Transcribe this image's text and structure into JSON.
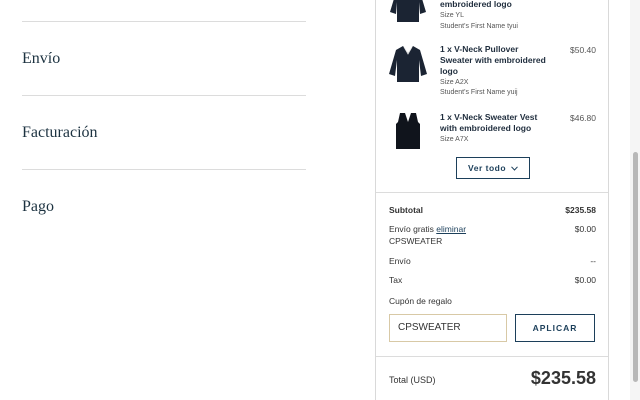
{
  "steps": [
    {
      "label": "Envío"
    },
    {
      "label": "Facturación"
    },
    {
      "label": "Pago"
    }
  ],
  "cart": {
    "items": [
      {
        "name": "embroidered logo",
        "size": "Size YL",
        "student": "Student's First Name tyui",
        "price": ""
      },
      {
        "name": "1 x V-Neck Pullover Sweater with embroidered logo",
        "size": "Size A2X",
        "student": "Student's First Name yuij",
        "price": "$50.40"
      },
      {
        "name": "1 x V-Neck Sweater Vest with embroidered logo",
        "size": "Size A7X",
        "student": "",
        "price": "$46.80"
      }
    ],
    "view_all_label": "Ver todo"
  },
  "summary": {
    "subtotal_label": "Subtotal",
    "subtotal_value": "$235.58",
    "free_shipping_label": "Envío gratis",
    "remove_label": "eliminar",
    "free_shipping_code": "CPSWEATER",
    "free_shipping_value": "$0.00",
    "shipping_label": "Envío",
    "shipping_value": "--",
    "tax_label": "Tax",
    "tax_value": "$0.00",
    "gift_coupon_label": "Cupón de regalo",
    "coupon_value": "CPSWEATER",
    "apply_label": "APLICAR",
    "total_label": "Total (USD)",
    "total_value": "$235.58"
  },
  "icons": {
    "chevron": "chevron-down-icon"
  }
}
